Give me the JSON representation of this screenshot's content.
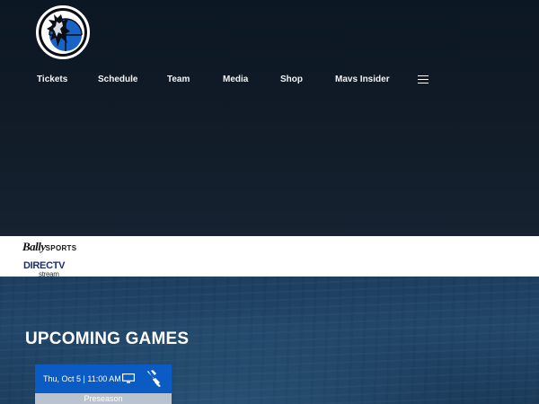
{
  "nav": {
    "items": [
      {
        "label": "Tickets",
        "name": "nav-item-tickets"
      },
      {
        "label": "Schedule",
        "name": "nav-item-schedule"
      },
      {
        "label": "Team",
        "name": "nav-item-team"
      },
      {
        "label": "Media",
        "name": "nav-item-media"
      },
      {
        "label": "Shop",
        "name": "nav-item-shop"
      },
      {
        "label": "Mavs Insider",
        "name": "nav-item-mavs-insider"
      }
    ],
    "menu_icon": "hamburger-menu-icon"
  },
  "logo": {
    "icon": "mavericks-logo-icon"
  },
  "sponsors": {
    "bally_main": "Bally",
    "bally_sub": "SPORTS",
    "directv_main": "DIRECTV",
    "directv_sub": "stream"
  },
  "games": {
    "title": "UPCOMING GAMES",
    "cards": [
      {
        "date_time": "Thu, Oct 5 | 11:00 AM",
        "broadcast_icon": "tv-icon",
        "opponent_icon": "opponent-team-logo-icon",
        "game_type": "Preseason"
      }
    ]
  },
  "colors": {
    "hero_bg": "#111b27",
    "sponsor_bg": "#ffffff",
    "card_blue": "#0a5bc4",
    "game_type_bg": "#b9c3cf"
  }
}
